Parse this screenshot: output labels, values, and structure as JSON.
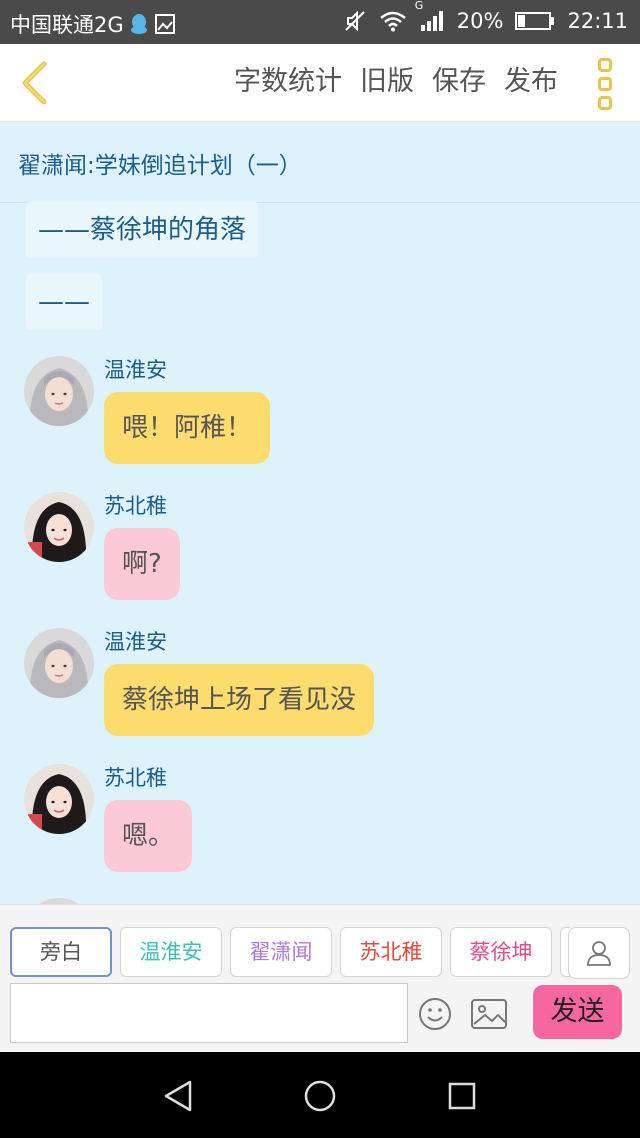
{
  "status_bar": {
    "carrier": "中国联通2G",
    "network_type": "G",
    "battery": "20%",
    "time": "22:11"
  },
  "toolbar": {
    "actions": [
      "字数统计",
      "旧版",
      "保存",
      "发布"
    ]
  },
  "chapter": {
    "title": "翟潇闻:学妹倒追计划（一）",
    "narration": [
      "——蔡徐坤的角落",
      "——"
    ]
  },
  "messages": [
    {
      "speaker": "温淮安",
      "text": "喂！阿稚！",
      "bubble_color": "#fedc6e"
    },
    {
      "speaker": "苏北稚",
      "text": "啊?",
      "bubble_color": "#fcc9d6"
    },
    {
      "speaker": "温淮安",
      "text": "蔡徐坤上场了看见没",
      "bubble_color": "#fedc6e"
    },
    {
      "speaker": "苏北稚",
      "text": "嗯。",
      "bubble_color": "#fcc9d6"
    }
  ],
  "composer": {
    "roles": [
      {
        "label": "旁白",
        "color": "#555555"
      },
      {
        "label": "温淮安",
        "color": "#3cc2b4"
      },
      {
        "label": "翟潇闻",
        "color": "#b07ad8"
      },
      {
        "label": "苏北稚",
        "color": "#e54a3c"
      },
      {
        "label": "蔡徐坤",
        "color": "#e04c8c"
      }
    ],
    "input_value": "",
    "send_label": "发送"
  },
  "colors": {
    "accent_yellow": "#e7c44a",
    "send_pink": "#f7679f",
    "background": "#ddf2fb"
  }
}
